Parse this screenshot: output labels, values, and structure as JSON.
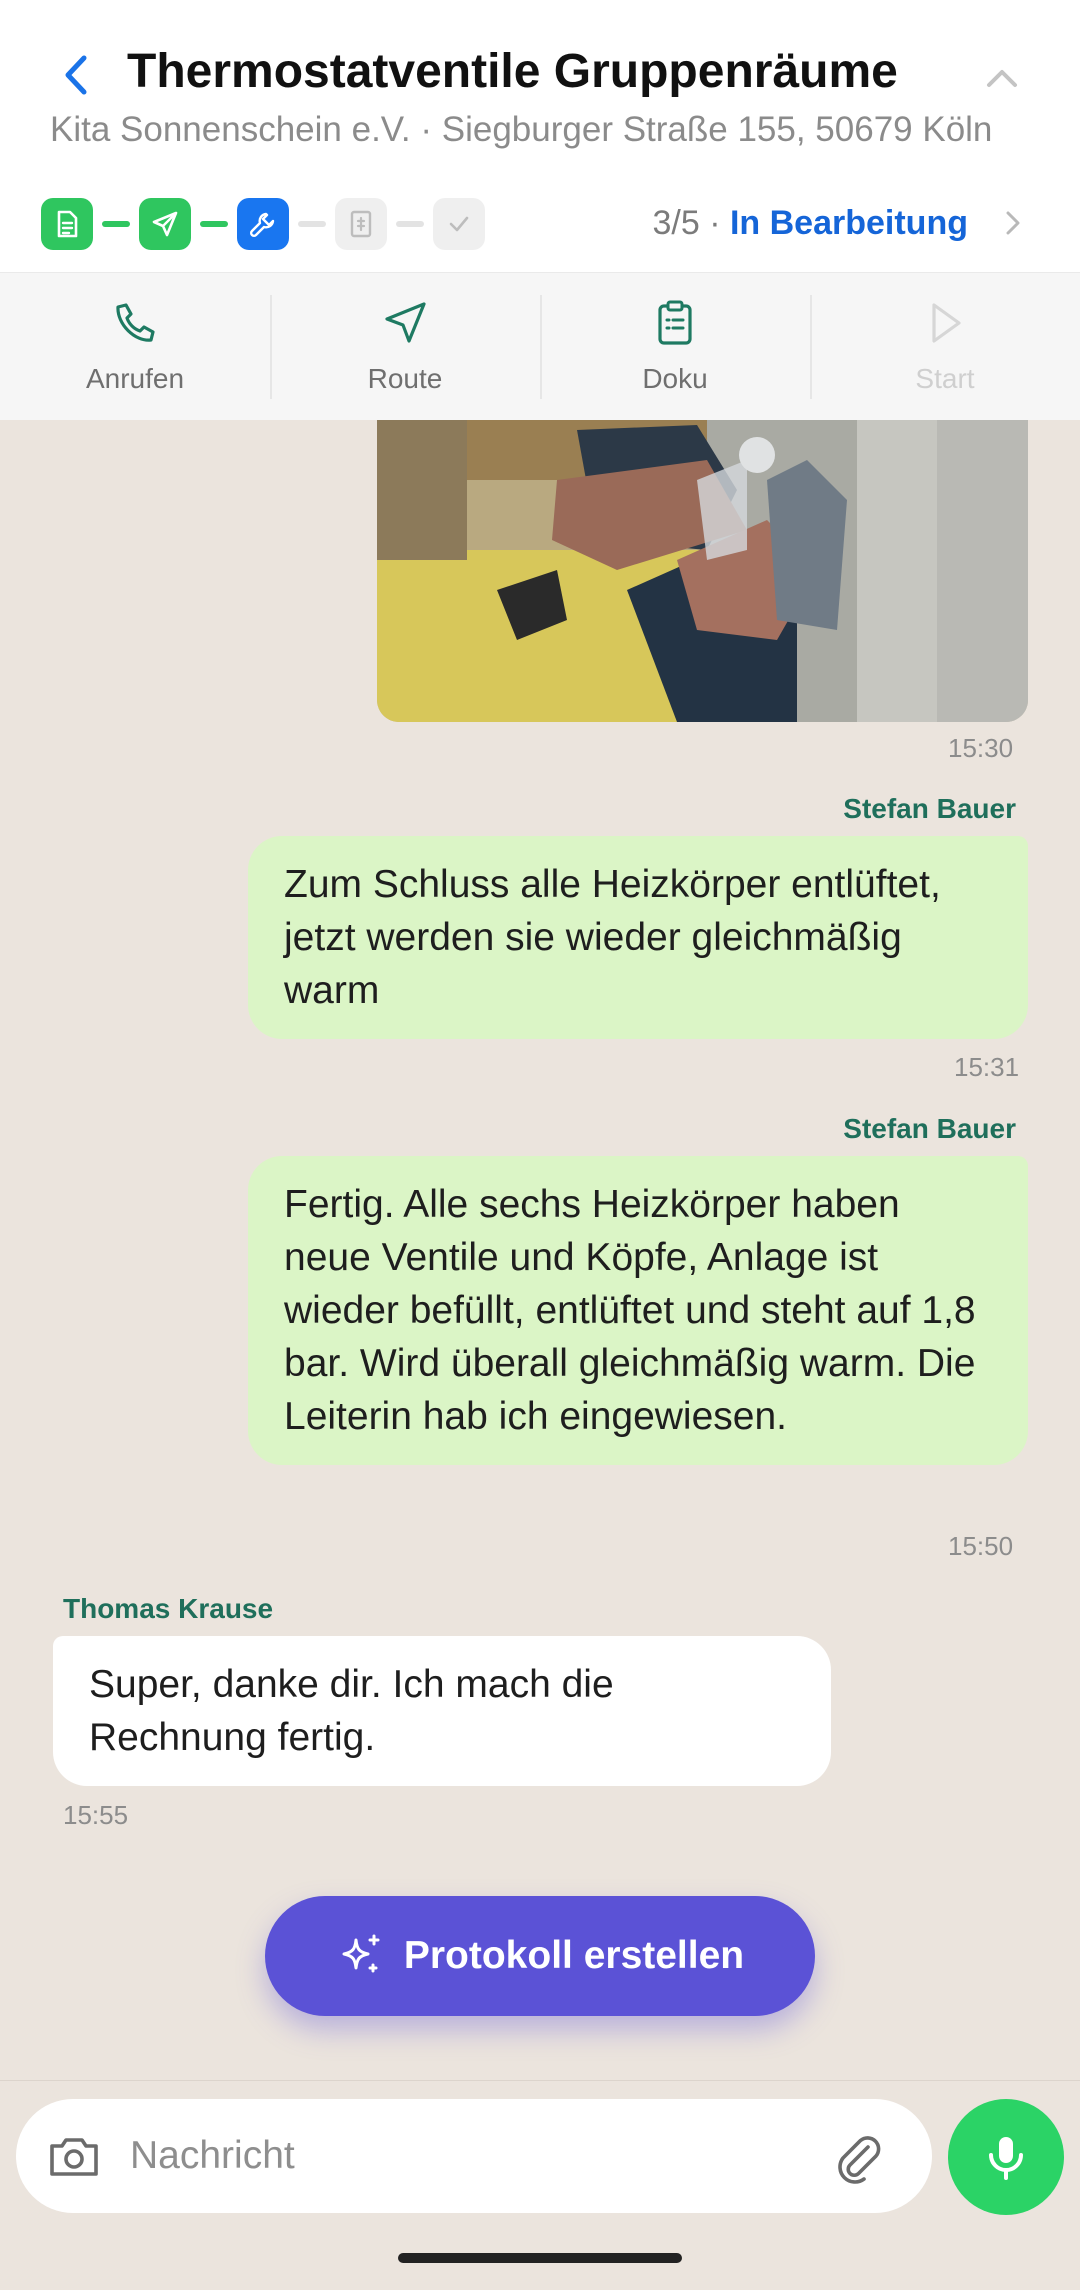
{
  "header": {
    "title": "Thermostatventile Gruppenräume",
    "subtitle": "Kita Sonnenschein e.V. · Siegburger Straße 155, 50679 Köln",
    "step_counter": "3/5",
    "separator": " · ",
    "status": "In Bearbeitung",
    "steps": [
      {
        "icon": "document-icon",
        "state": "done"
      },
      {
        "icon": "send-icon",
        "state": "done"
      },
      {
        "icon": "wrench-icon",
        "state": "active"
      },
      {
        "icon": "invoice-icon",
        "state": "todo"
      },
      {
        "icon": "check-icon",
        "state": "todo"
      }
    ],
    "colors": {
      "done": "#2fc65f",
      "active": "#1976f0",
      "status": "#1565d8"
    }
  },
  "actions": [
    {
      "label": "Anrufen",
      "icon": "phone-icon"
    },
    {
      "label": "Route",
      "icon": "navigation-icon"
    },
    {
      "label": "Doku",
      "icon": "clipboard-icon"
    },
    {
      "label": "Start",
      "icon": "play-icon",
      "disabled": true
    }
  ],
  "messages": [
    {
      "type": "image",
      "direction": "out",
      "description_icon": "photo-radiator-valve",
      "time": "15:30"
    },
    {
      "direction": "out",
      "sender": "Stefan Bauer",
      "text": "Zum Schluss alle Heizkörper entlüftet, jetzt werden sie wieder gleichmäßig warm",
      "time": "15:31"
    },
    {
      "direction": "out",
      "sender": "Stefan Bauer",
      "text": "Fertig. Alle sechs Heizkörper haben neue Ventile und Köpfe, Anlage ist wieder befüllt, entlüftet und steht auf 1,8 bar. Wird überall gleichmäßig warm. Die Leiterin hab ich eingewiesen.",
      "time": "15:50"
    },
    {
      "direction": "in",
      "sender": "Thomas Krause",
      "text": "Super, danke dir. Ich mach die Rechnung fertig.",
      "time": "15:55"
    }
  ],
  "protocol_button": {
    "label": "Protokoll erstellen",
    "icon": "sparkles-icon",
    "color": "#5b52d6"
  },
  "composer": {
    "placeholder": "Nachricht",
    "value": "",
    "mic_color": "#2bd366"
  }
}
